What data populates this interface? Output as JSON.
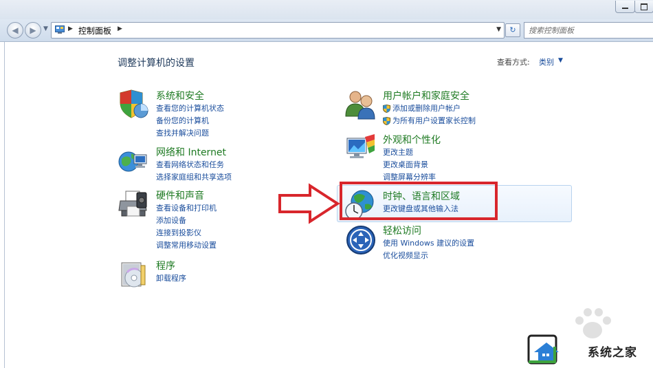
{
  "navbar": {
    "breadcrumb": "控制面板",
    "search_placeholder": "搜索控制面板"
  },
  "content": {
    "title": "调整计算机的设置",
    "view_by_label": "查看方式:",
    "view_by_value": "类别"
  },
  "categories_left": [
    {
      "title": "系统和安全",
      "icon": "shield-chart-icon",
      "links": [
        "查看您的计算机状态",
        "备份您的计算机",
        "查找并解决问题"
      ]
    },
    {
      "title": "网络和 Internet",
      "icon": "network-globe-icon",
      "links": [
        "查看网络状态和任务",
        "选择家庭组和共享选项"
      ]
    },
    {
      "title": "硬件和声音",
      "icon": "printer-icon",
      "links": [
        "查看设备和打印机",
        "添加设备",
        "连接到投影仪",
        "调整常用移动设置"
      ]
    },
    {
      "title": "程序",
      "icon": "programs-disc-icon",
      "links": [
        "卸载程序"
      ]
    }
  ],
  "categories_right": [
    {
      "title": "用户帐户和家庭安全",
      "icon": "users-icon",
      "links": [
        "添加或删除用户帐户",
        "为所有用户设置家长控制"
      ]
    },
    {
      "title": "外观和个性化",
      "icon": "appearance-monitor-icon",
      "links": [
        "更改主题",
        "更改桌面背景",
        "调整屏幕分辨率"
      ]
    },
    {
      "title": "时钟、语言和区域",
      "icon": "clock-globe-icon",
      "links": [
        "更改键盘或其他输入法"
      ]
    },
    {
      "title": "轻松访问",
      "icon": "ease-of-access-icon",
      "links": [
        "使用 Windows 建议的设置",
        "优化视频显示"
      ]
    }
  ],
  "watermark": {
    "text": "系统之家"
  },
  "colors": {
    "category_title": "#1e7a22",
    "link": "#1a4d9c",
    "highlight_red": "#d8262c"
  }
}
